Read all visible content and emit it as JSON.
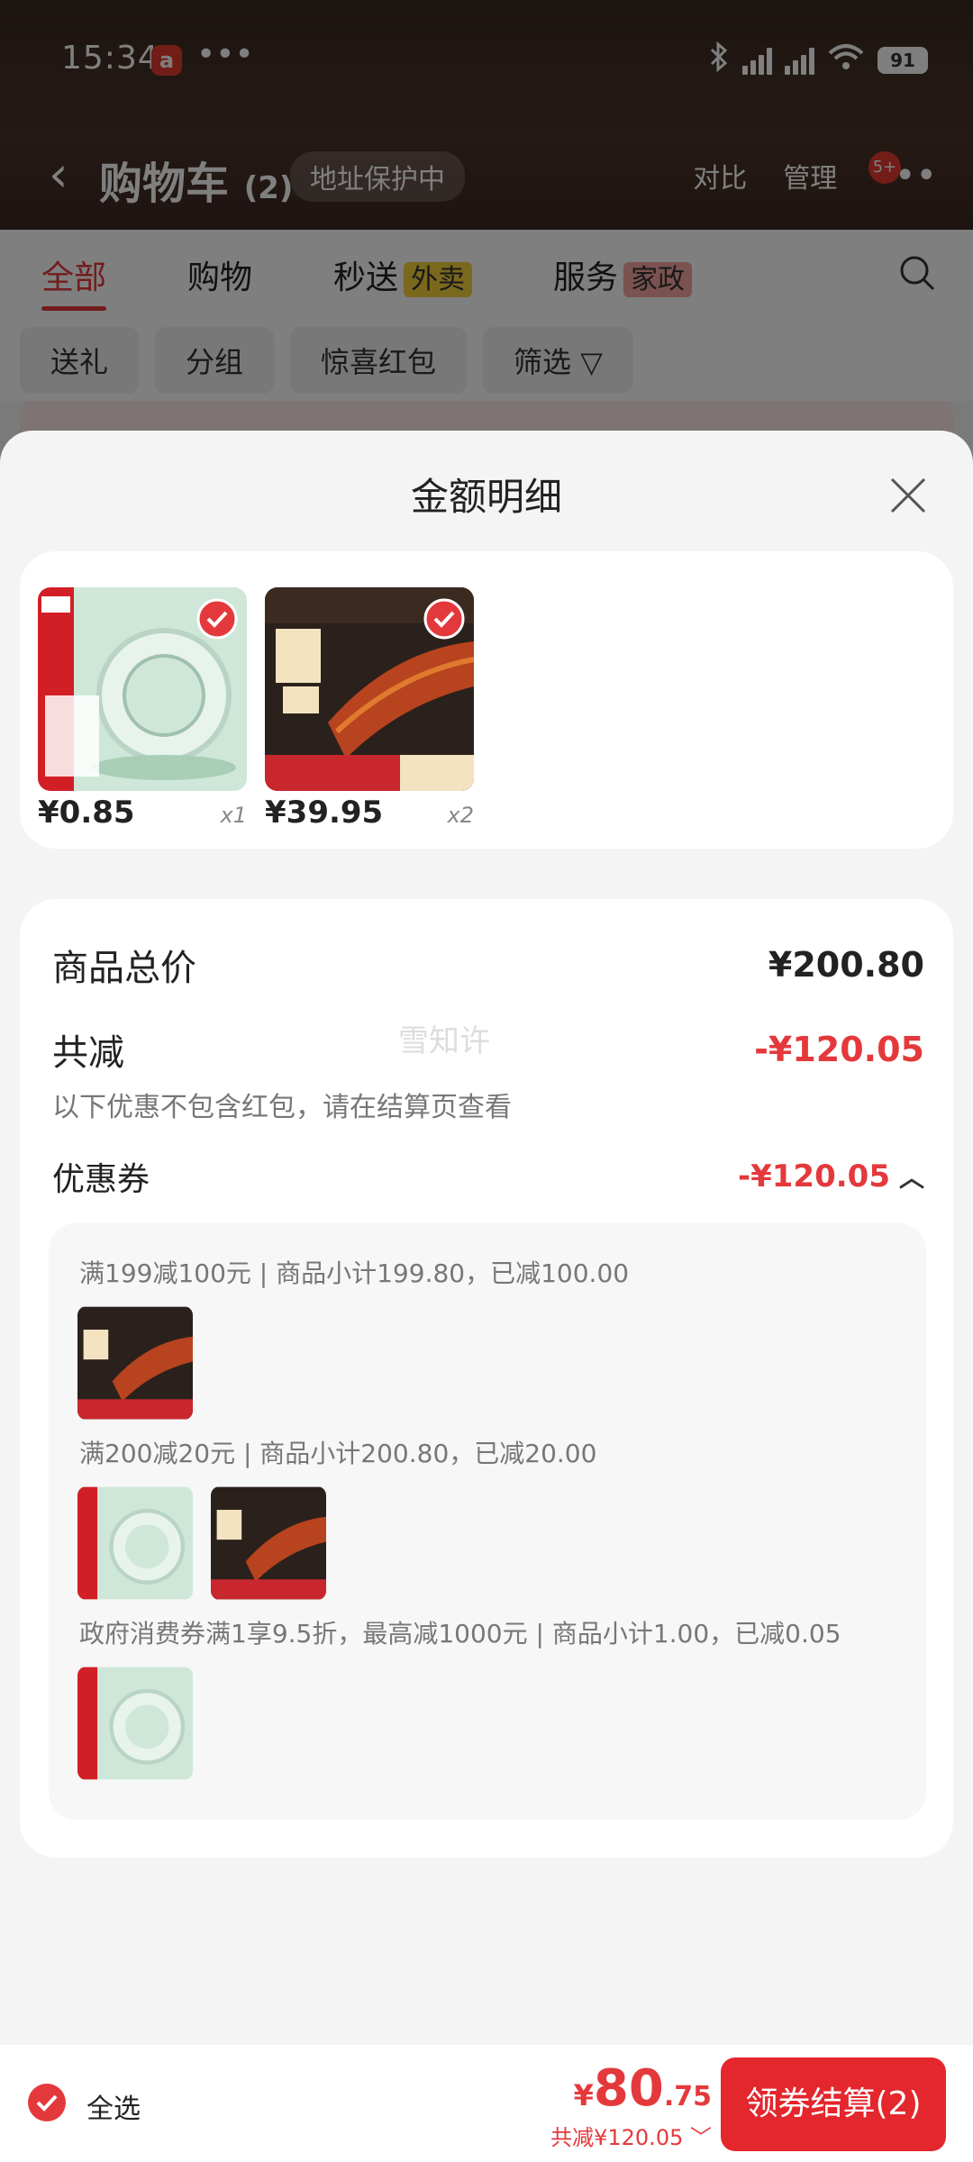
{
  "status_bar": {
    "time": "15:34",
    "app_icon": "a",
    "more": "•••",
    "network": "5G",
    "battery": "91"
  },
  "header": {
    "title": "购物车",
    "count": "(2)",
    "address_chip": "地址保护中",
    "compare": "对比",
    "manage": "管理",
    "more_badge": "5+"
  },
  "tabs": [
    {
      "label": "全部"
    },
    {
      "label": "购物"
    },
    {
      "label": "秒送",
      "tag": "外卖"
    },
    {
      "label": "服务",
      "tag": "家政"
    }
  ],
  "filters": [
    "送礼",
    "分组",
    "惊喜红包",
    "筛选"
  ],
  "sheet": {
    "title": "金额明细",
    "items": [
      {
        "price": "¥0.85",
        "qty": "x1"
      },
      {
        "price": "¥39.95",
        "qty": "x2"
      }
    ],
    "product_total_label": "商品总价",
    "product_total_value": "¥200.80",
    "discount_label": "共减",
    "discount_value": "-¥120.05",
    "discount_note": "以下优惠不包含红包，请在结算页查看",
    "coupon_label": "优惠券",
    "coupon_value": "-¥120.05",
    "coupons": [
      "满199减100元 | 商品小计199.80，已减100.00",
      "满200减20元 | 商品小计200.80，已减20.00",
      "政府消费券满1享9.5折，最高减1000元 | 商品小计1.00，已减0.05"
    ],
    "watermark": "雪知许"
  },
  "bottom_bar": {
    "select_all": "全选",
    "total_yen": "¥",
    "total_int": "80",
    "total_dec": ".75",
    "total_sub": "共减¥120.05",
    "checkout": "领券结算(2)"
  },
  "colors": {
    "accent": "#e4393c",
    "checkout_bg": "#e4262d"
  }
}
